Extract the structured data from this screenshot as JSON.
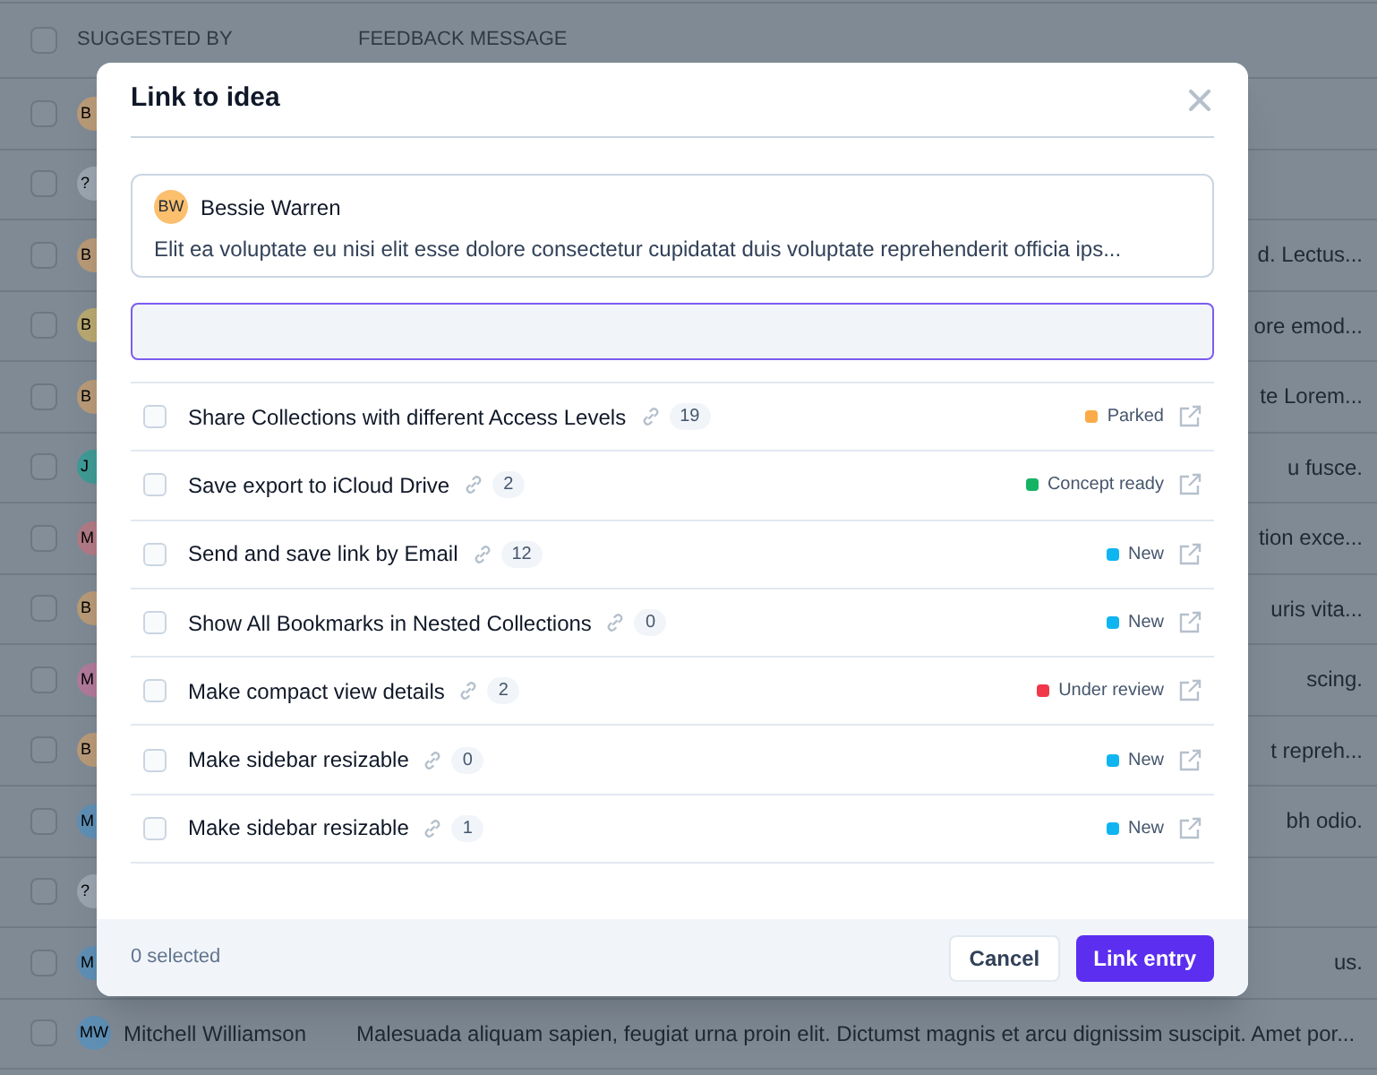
{
  "table": {
    "columns": [
      "SUGGESTED BY",
      "FEEDBACK MESSAGE"
    ],
    "select_all_checked": false,
    "rows": [
      {
        "checked": false,
        "avatar": "B",
        "color": "#b89a78",
        "name": "",
        "message": ""
      },
      {
        "checked": false,
        "avatar": "?",
        "color": "#9aa5b0",
        "name": "",
        "message": ""
      },
      {
        "checked": false,
        "avatar": "B",
        "color": "#b89a78",
        "name": "",
        "message": "d. Lectus..."
      },
      {
        "checked": false,
        "avatar": "B",
        "color": "#b8a870",
        "name": "",
        "message": "ore emod..."
      },
      {
        "checked": false,
        "avatar": "B",
        "color": "#b89a78",
        "name": "",
        "message": "te Lorem..."
      },
      {
        "checked": false,
        "avatar": "J",
        "color": "#3f9a95",
        "name": "",
        "message": "u fusce."
      },
      {
        "checked": false,
        "avatar": "M",
        "color": "#b07a85",
        "name": "",
        "message": "tion exce..."
      },
      {
        "checked": false,
        "avatar": "B",
        "color": "#b89a78",
        "name": "",
        "message": "uris vita..."
      },
      {
        "checked": false,
        "avatar": "M",
        "color": "#b07a9a",
        "name": "",
        "message": "scing."
      },
      {
        "checked": false,
        "avatar": "B",
        "color": "#b89a78",
        "name": "",
        "message": "t repreh..."
      },
      {
        "checked": false,
        "avatar": "M",
        "color": "#5f8fb5",
        "name": "",
        "message": "bh odio."
      },
      {
        "checked": false,
        "avatar": "?",
        "color": "#9aa5b0",
        "name": "",
        "message": ""
      },
      {
        "checked": false,
        "avatar": "M",
        "color": "#5f8fb5",
        "name": "",
        "message": "us."
      },
      {
        "checked": false,
        "avatar": "MW",
        "color": "#5f8fb5",
        "name": "Mitchell Williamson",
        "message": "Malesuada aliquam sapien, feugiat urna proin elit. Dictumst magnis et arcu dignissim suscipit. Amet por..."
      }
    ]
  },
  "dialog": {
    "title": "Link to idea",
    "feedback": {
      "avatar": "BW",
      "name": "Bessie Warren",
      "message": "Elit ea voluptate eu nisi elit esse dolore consectetur cupidatat duis voluptate reprehenderit officia ips..."
    },
    "ideas": [
      {
        "title": "Share Collections with different Access Levels",
        "count": "19",
        "status": "Parked",
        "color": "#fbab4a",
        "checked": false
      },
      {
        "title": "Save export to iCloud Drive",
        "count": "2",
        "status": "Concept ready",
        "color": "#16b364",
        "checked": false
      },
      {
        "title": "Send and save link by Email",
        "count": "12",
        "status": "New",
        "color": "#0fb5f0",
        "checked": false
      },
      {
        "title": "Show All Bookmarks in Nested Collections",
        "count": "0",
        "status": "New",
        "color": "#0fb5f0",
        "checked": false
      },
      {
        "title": "Make compact view details",
        "count": "2",
        "status": "Under review",
        "color": "#f0384a",
        "checked": false
      },
      {
        "title": "Make sidebar resizable",
        "count": "0",
        "status": "New",
        "color": "#0fb5f0",
        "checked": false
      },
      {
        "title": "Make sidebar resizable",
        "count": "1",
        "status": "New",
        "color": "#0fb5f0",
        "checked": false
      }
    ],
    "selected_count": "0 selected",
    "buttons": [
      "Cancel",
      "Link entry"
    ]
  }
}
